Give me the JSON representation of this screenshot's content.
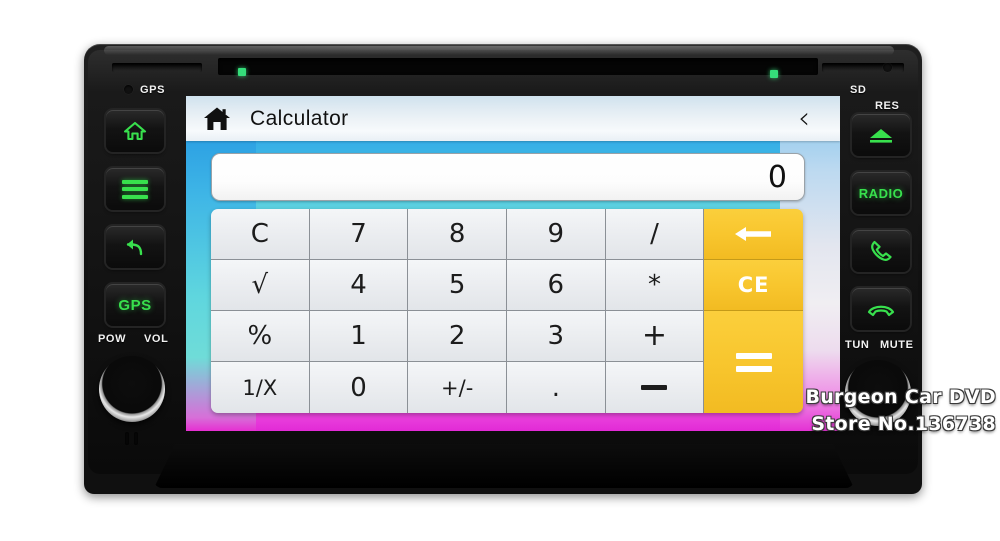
{
  "device": {
    "bezel_labels": {
      "gps": "GPS",
      "sd": "SD",
      "res": "RES",
      "pow": "POW",
      "vol": "VOL",
      "tun": "TUN",
      "mute": "MUTE"
    },
    "left_buttons": [
      {
        "name": "home",
        "icon": "home-icon",
        "label": ""
      },
      {
        "name": "menu",
        "icon": "menu-bars-icon",
        "label": ""
      },
      {
        "name": "back",
        "icon": "back-arrow-icon",
        "label": ""
      },
      {
        "name": "gps",
        "icon": "",
        "label": "GPS"
      }
    ],
    "right_buttons": [
      {
        "name": "eject",
        "icon": "eject-icon",
        "label": ""
      },
      {
        "name": "radio",
        "icon": "",
        "label": "RADIO"
      },
      {
        "name": "call",
        "icon": "phone-answer-icon",
        "label": ""
      },
      {
        "name": "hangup",
        "icon": "phone-hangup-icon",
        "label": ""
      }
    ],
    "knobs": [
      {
        "name": "power-volume-knob"
      },
      {
        "name": "tune-mute-knob"
      }
    ]
  },
  "screen": {
    "titlebar": {
      "home_icon": "home-icon",
      "title": "Calculator",
      "back_icon": "chevron-left-icon",
      "back_glyph": "‹"
    },
    "display": {
      "value": "0"
    },
    "keypad": {
      "rows": [
        [
          {
            "label": "C",
            "kind": "fn"
          },
          {
            "label": "7",
            "kind": "num"
          },
          {
            "label": "8",
            "kind": "num"
          },
          {
            "label": "9",
            "kind": "num"
          },
          {
            "label": "/",
            "kind": "op"
          },
          {
            "label": "←",
            "kind": "accent",
            "name": "backspace-key"
          }
        ],
        [
          {
            "label": "√",
            "kind": "fn"
          },
          {
            "label": "4",
            "kind": "num"
          },
          {
            "label": "5",
            "kind": "num"
          },
          {
            "label": "6",
            "kind": "num"
          },
          {
            "label": "*",
            "kind": "op"
          },
          {
            "label": "CE",
            "kind": "accent",
            "name": "clear-entry-key"
          }
        ],
        [
          {
            "label": "%",
            "kind": "fn"
          },
          {
            "label": "1",
            "kind": "num"
          },
          {
            "label": "2",
            "kind": "num"
          },
          {
            "label": "3",
            "kind": "num"
          },
          {
            "label": "+",
            "kind": "op"
          },
          {
            "label": "=",
            "kind": "accent",
            "name": "equals-key"
          }
        ],
        [
          {
            "label": "1/X",
            "kind": "fn"
          },
          {
            "label": "0",
            "kind": "num"
          },
          {
            "label": "+/-",
            "kind": "fn"
          },
          {
            "label": ".",
            "kind": "num"
          },
          {
            "label": "−",
            "kind": "op"
          },
          {
            "label": "",
            "kind": "accent-span",
            "name": "equals-key-extension"
          }
        ]
      ]
    }
  },
  "watermark": {
    "line1": "Burgeon Car  DVD",
    "line2": "Store No.136738"
  },
  "colors": {
    "accent_yellow": "#f8c62e",
    "button_green": "#38e04d",
    "bezel_black": "#121212",
    "screen_blue": "#2ea6e8",
    "screen_magenta": "#e22ad6"
  }
}
